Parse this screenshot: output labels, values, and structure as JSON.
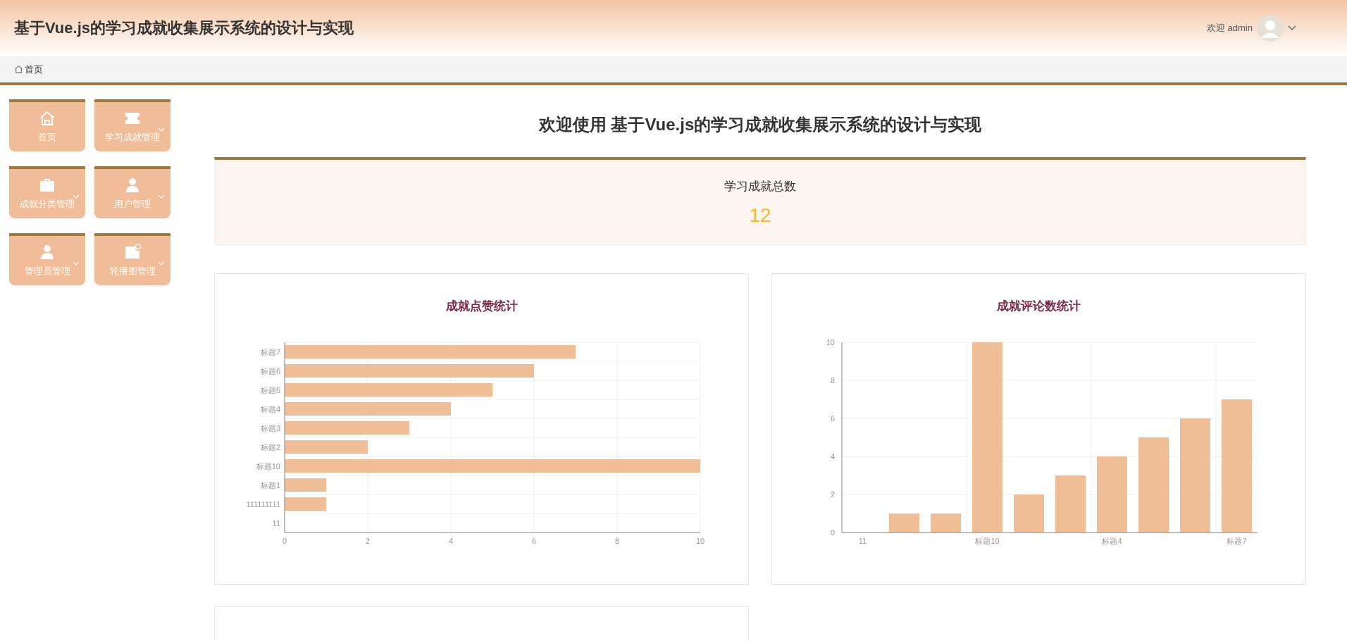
{
  "header": {
    "title": "基于Vue.js的学习成就收集展示系统的设计与实现",
    "welcome": "欢迎 admin"
  },
  "breadcrumb": {
    "items": [
      "首页"
    ]
  },
  "sidebar": {
    "items": [
      {
        "label": "首页",
        "has_submenu": false
      },
      {
        "label": "学习成就管理",
        "has_submenu": true
      },
      {
        "label": "成就分类管理",
        "has_submenu": true
      },
      {
        "label": "用户管理",
        "has_submenu": true
      },
      {
        "label": "管理员管理",
        "has_submenu": true
      },
      {
        "label": "轮播图管理",
        "has_submenu": true
      }
    ]
  },
  "main": {
    "heading": "欢迎使用 基于Vue.js的学习成就收集展示系统的设计与实现",
    "stat": {
      "label": "学习成就总数",
      "value": "12"
    },
    "charts": [
      {
        "title": "成就点赞统计",
        "chart_data": {
          "type": "bar",
          "orientation": "horizontal",
          "grid": true,
          "categories": [
            "标题7",
            "标题6",
            "标题5",
            "标题4",
            "标题3",
            "标题2",
            "标题10",
            "标题1",
            "111111111",
            "11"
          ],
          "values": [
            7,
            6,
            5,
            4,
            3,
            2,
            10,
            1,
            1,
            0
          ],
          "xlim": [
            0,
            10
          ],
          "xticks": [
            0,
            2,
            4,
            6,
            8,
            10
          ]
        }
      },
      {
        "title": "成就评论数统计",
        "chart_data": {
          "type": "bar",
          "orientation": "vertical",
          "grid": true,
          "categories": [
            "11",
            null,
            null,
            "标题10",
            null,
            null,
            "标题4",
            null,
            null,
            "标题7"
          ],
          "values": [
            0,
            1,
            1,
            10,
            2,
            3,
            4,
            5,
            6,
            7
          ],
          "ylim": [
            0,
            10
          ],
          "yticks": [
            0,
            2,
            4,
            6,
            8,
            10
          ]
        }
      }
    ]
  }
}
